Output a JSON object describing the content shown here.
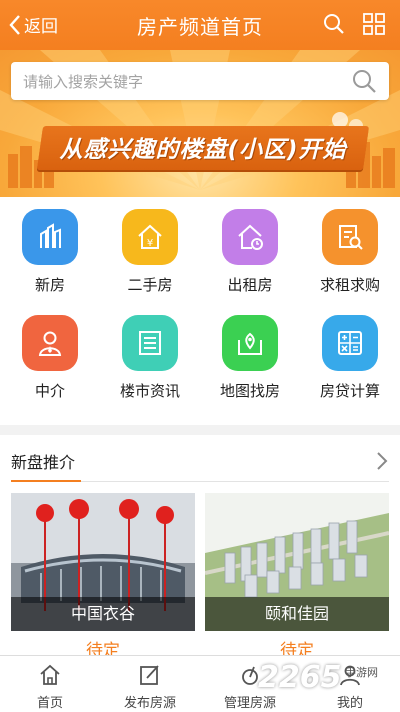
{
  "header": {
    "back_label": "返回",
    "title": "房产频道首页"
  },
  "search": {
    "placeholder": "请输入搜索关键字"
  },
  "banner": {
    "slogan": "从感兴趣的楼盘(小区)开始"
  },
  "categories": [
    {
      "label": "新房",
      "color": "#3a97ea",
      "icon": "new-house-icon"
    },
    {
      "label": "二手房",
      "color": "#f7b81c",
      "icon": "second-hand-house-icon"
    },
    {
      "label": "出租房",
      "color": "#c27ee8",
      "icon": "rental-house-icon"
    },
    {
      "label": "求租求购",
      "color": "#f5922d",
      "icon": "wanted-icon"
    },
    {
      "label": "中介",
      "color": "#f0653f",
      "icon": "agent-icon"
    },
    {
      "label": "楼市资讯",
      "color": "#3fcfb6",
      "icon": "news-icon"
    },
    {
      "label": "地图找房",
      "color": "#3bd052",
      "icon": "map-icon"
    },
    {
      "label": "房贷计算",
      "color": "#37a9ea",
      "icon": "calculator-icon"
    }
  ],
  "new_projects": {
    "heading": "新盘推介",
    "items": [
      {
        "name": "中国衣谷",
        "status": "待定"
      },
      {
        "name": "颐和佳园",
        "status": "待定"
      }
    ]
  },
  "tabbar": {
    "items": [
      {
        "label": "首页",
        "icon": "home-icon"
      },
      {
        "label": "发布房源",
        "icon": "edit-icon"
      },
      {
        "label": "管理房源",
        "icon": "manage-icon"
      },
      {
        "label": "我的",
        "icon": "user-icon"
      }
    ]
  },
  "watermark": {
    "text": "2265",
    "sub": "手游网"
  },
  "colors": {
    "accent": "#f47f20",
    "banner": "#f8a83a"
  }
}
